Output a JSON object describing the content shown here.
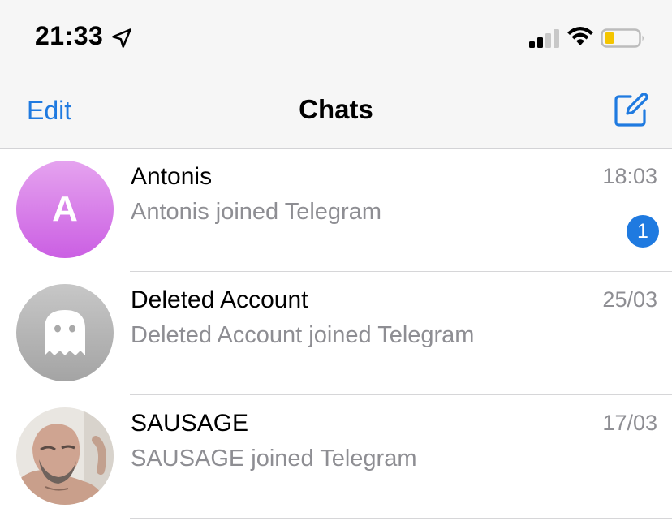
{
  "status_bar": {
    "time": "21:33",
    "icons": [
      "location-arrow-icon",
      "cellular-signal-icon",
      "wifi-icon",
      "battery-low-icon"
    ],
    "battery_color": "#f4c500"
  },
  "nav": {
    "edit_label": "Edit",
    "title": "Chats",
    "compose_icon": "compose-icon",
    "accent_color": "#1f7ae0"
  },
  "chats": [
    {
      "name": "Antonis",
      "time": "18:03",
      "preview": "Antonis joined Telegram",
      "avatar_letter": "A",
      "unread": "1"
    },
    {
      "name": "Deleted Account",
      "time": "25/03",
      "preview": "Deleted Account joined Telegram",
      "avatar_icon": "ghost-icon"
    },
    {
      "name": "SAUSAGE",
      "time": "17/03",
      "preview": "SAUSAGE joined Telegram",
      "avatar_icon": "profile-photo"
    }
  ]
}
